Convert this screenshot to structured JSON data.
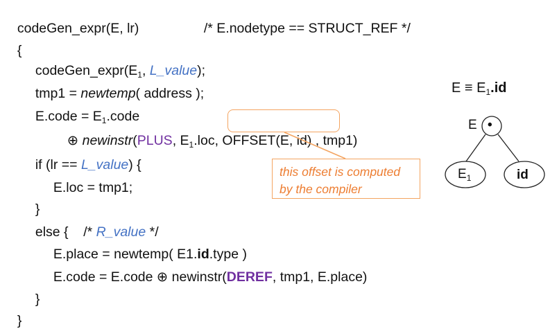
{
  "code": {
    "l1_fn": "codeGen_expr(E, lr)",
    "l1_comment": "/* E.nodetype == STRUCT_REF */",
    "l2": "{",
    "l3_pre": "codeGen_expr(E",
    "l3_sub": "1",
    "l3_mid": ", ",
    "l3_blue": "L_value",
    "l3_post": ");",
    "l4_pre": "tmp1 = ",
    "l4_ital": "newtemp",
    "l4_post": "( address );",
    "l5_pre": "E.code = E",
    "l5_sub": "1",
    "l5_post": ".code",
    "l6_op": "⊕ ",
    "l6_ital": "newinstr",
    "l6_paren": "(",
    "l6_purple": "PLUS",
    "l6_mid": ", E",
    "l6_sub": "1",
    "l6_loc": ".loc, ",
    "l6_offset": "OFFSET(E, id)",
    "l6_post": " , tmp1)",
    "l7_pre": "if (lr == ",
    "l7_blue": "L_value",
    "l7_post": ") {",
    "l8": "E.loc = tmp1;",
    "l9": "}",
    "l10_pre": "else {    /* ",
    "l10_blue": "R_value",
    "l10_post": " */",
    "l11_pre": "E.place = newtemp( E1.",
    "l11_bold": "id",
    "l11_post": ".type )",
    "l12_pre": "E.code = E.code ⊕ newinstr(",
    "l12_purple": "DEREF",
    "l12_post": ", tmp1, E.place)",
    "l13": "}",
    "l14": "}"
  },
  "callout": {
    "line1": "this offset is computed",
    "line2": "by the compiler"
  },
  "tree": {
    "equiv_pre": "E ≡ E",
    "equiv_sub": "1",
    "equiv_dot": ".",
    "equiv_bold": "id",
    "root_label": "E",
    "root_symbol": "•",
    "left_child": "E",
    "left_sub": "1",
    "right_child": "id"
  },
  "colors": {
    "blue": "#4472c4",
    "purple": "#7030a0",
    "orange": "#ed7d31"
  }
}
